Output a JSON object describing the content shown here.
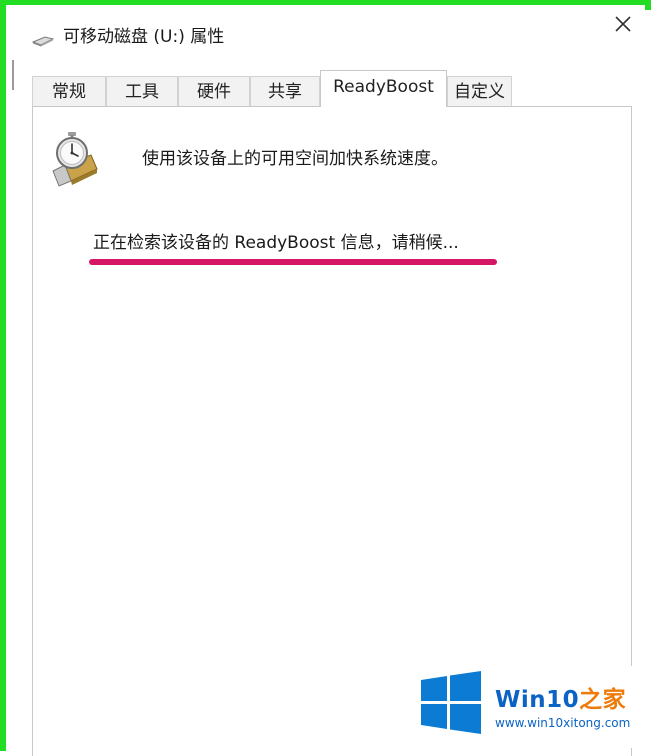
{
  "window": {
    "title": "可移动磁盘 (U:) 属性",
    "title_icon": "usb-drive-icon",
    "close_icon": "close-icon"
  },
  "tabs": [
    {
      "label": "常规",
      "active": false
    },
    {
      "label": "工具",
      "active": false
    },
    {
      "label": "硬件",
      "active": false
    },
    {
      "label": "共享",
      "active": false
    },
    {
      "label": "ReadyBoost",
      "active": true
    },
    {
      "label": "自定义",
      "active": false
    }
  ],
  "readyboost": {
    "icon": "readyboost-stopwatch-icon",
    "description": "使用该设备上的可用空间加快系统速度。",
    "status": "正在检索该设备的 ReadyBoost 信息，请稍候..."
  },
  "annotation": {
    "underline_color": "#d51565"
  },
  "watermark": {
    "brand_main": "Win10",
    "brand_accent": "之家",
    "url": "www.win10xitong.com",
    "logo": "windows-logo-icon"
  },
  "colors": {
    "frame_border": "#22dd22",
    "brand_blue": "#0b63c4",
    "brand_orange": "#ee7a0a"
  }
}
